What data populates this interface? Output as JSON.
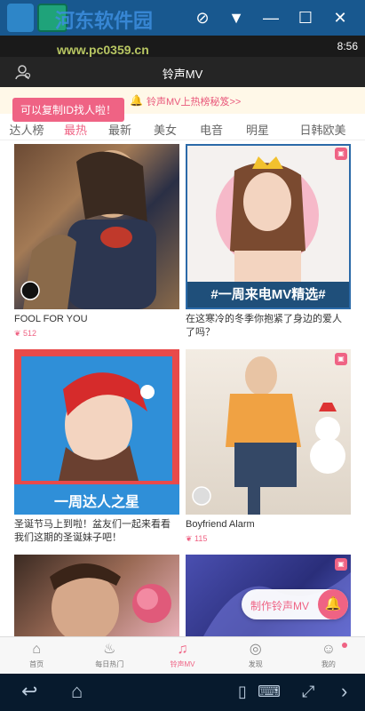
{
  "window": {
    "watermark_title": "河东软件园",
    "watermark_url": "www.pc0359.cn",
    "controls": [
      "⊘",
      "▼",
      "—",
      "☐",
      "✕"
    ]
  },
  "status_bar": {
    "time": "8:56"
  },
  "header": {
    "title": "铃声MV",
    "user_icon": "user-search-icon"
  },
  "banner": {
    "text": "铃声MV上热榜秘笈>>",
    "icon": "bell-icon"
  },
  "tooltip": {
    "text": "可以复制ID找人啦！"
  },
  "tabs": [
    {
      "label": "达人榜",
      "active": false
    },
    {
      "label": "最热",
      "active": true
    },
    {
      "label": "最新",
      "active": false
    },
    {
      "label": "美女",
      "active": false
    },
    {
      "label": "电音",
      "active": false
    },
    {
      "label": "明星",
      "active": false
    },
    {
      "label": "日韩欧美",
      "active": false
    }
  ],
  "cards": [
    {
      "title": "FOOL FOR YOU",
      "count": "512",
      "overlay": ""
    },
    {
      "title": "在这寒冷的冬季你抱紧了身边的爱人了吗？",
      "count": "",
      "overlay": "#一周来电MV精选#"
    },
    {
      "title": "圣诞节马上到啦！盆友们一起来看看我们这期的圣诞妹子吧！",
      "count": "",
      "overlay": "一周达人之星"
    },
    {
      "title": "Boyfriend Alarm",
      "count": "115",
      "overlay": ""
    }
  ],
  "fab": {
    "text": "制作铃声MV",
    "icon": "bell-icon"
  },
  "bottom_nav": [
    {
      "label": "首页",
      "icon": "home-icon",
      "active": false
    },
    {
      "label": "每日热门",
      "icon": "flame-icon",
      "active": false
    },
    {
      "label": "铃声MV",
      "icon": "music-video-icon",
      "active": true
    },
    {
      "label": "发现",
      "icon": "compass-icon",
      "active": false
    },
    {
      "label": "我的",
      "icon": "person-icon",
      "active": false
    }
  ],
  "colors": {
    "accent": "#ef6384",
    "header": "#252525",
    "window_bar": "#18588f"
  }
}
